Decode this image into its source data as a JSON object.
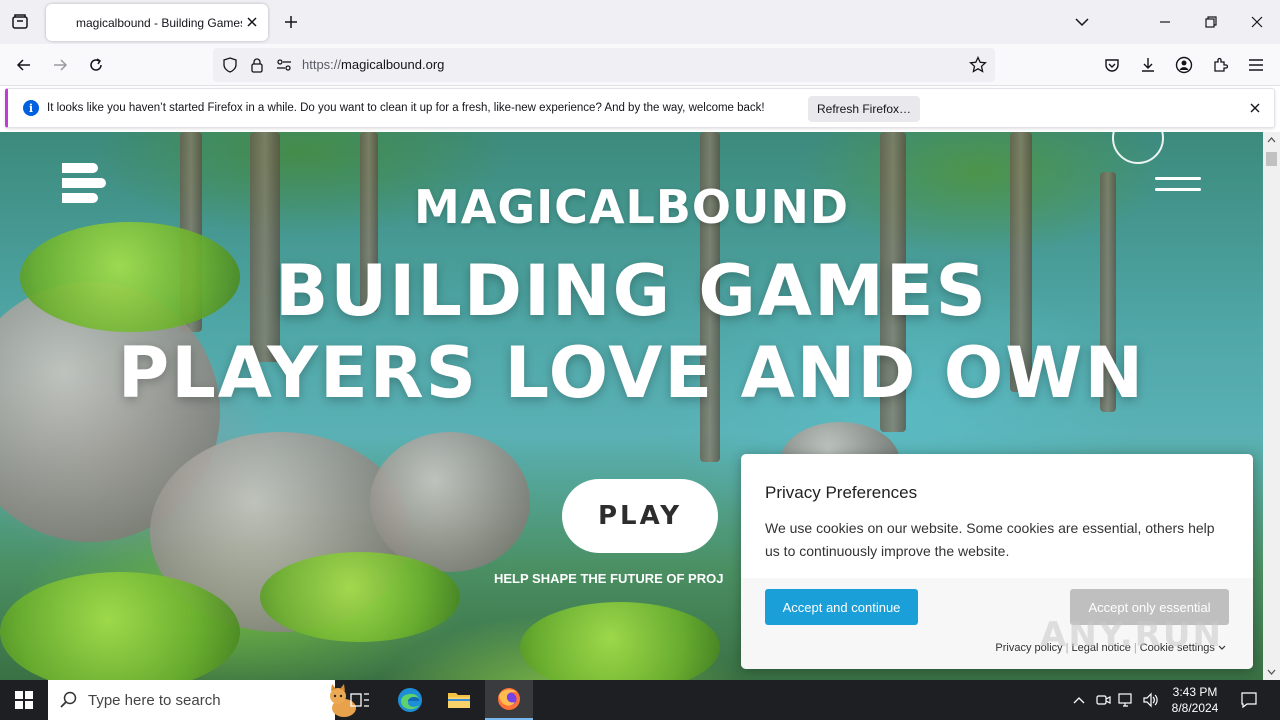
{
  "browser": {
    "tab": {
      "title": "magicalbound - Building Games"
    },
    "url": {
      "scheme": "https://",
      "host": "magicalbound.org"
    }
  },
  "notification": {
    "message": "It looks like you haven’t started Firefox in a while. Do you want to clean it up for a fresh, like-new experience? And by the way, welcome back!",
    "button_label": "Refresh Firefox…"
  },
  "page": {
    "brand": "MAGICALBOUND",
    "hero_line_1": "BUILDING GAMES",
    "hero_line_2": "PLAYERS LOVE AND OWN",
    "play_label": "PLAY",
    "help_text": "HELP SHAPE THE FUTURE OF PROJ"
  },
  "cookie": {
    "title": "Privacy Preferences",
    "body": "We use cookies on our website. Some cookies are essential, others help us to continuously improve the website.",
    "accept_label": "Accept and continue",
    "essential_label": "Accept only essential",
    "links": {
      "privacy": "Privacy policy",
      "legal": "Legal notice",
      "settings": "Cookie settings"
    }
  },
  "watermark": "ANY.RUN",
  "taskbar": {
    "search_placeholder": "Type here to search",
    "time": "3:43 PM",
    "date": "8/8/2024"
  },
  "colors": {
    "accent": "#1a9fd8",
    "notification_stripe": "#c13bd6",
    "firefox_info": "#0060df",
    "taskbar": "#1e1f22"
  }
}
